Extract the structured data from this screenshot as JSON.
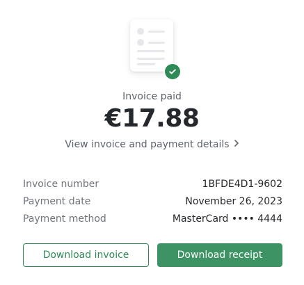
{
  "status": {
    "label": "Invoice paid",
    "amount": "€17.88"
  },
  "links": {
    "details": "View invoice and payment details"
  },
  "invoice": {
    "rows": [
      {
        "label": "Invoice number",
        "value": "1BFDE4D1-9602"
      },
      {
        "label": "Payment date",
        "value": "November 26, 2023"
      },
      {
        "label": "Payment method",
        "value": "MasterCard •••• 4444"
      }
    ]
  },
  "actions": {
    "download_invoice": "Download invoice",
    "download_receipt": "Download receipt"
  },
  "icons": {
    "illustration": "invoice-document-icon",
    "badge": "checkmark-icon",
    "link_chevron": "chevron-right-icon"
  },
  "colors": {
    "accent": "#2e8b57",
    "accent_filled": "#3d9364",
    "muted_text": "#5d636b",
    "text": "#25282c"
  }
}
